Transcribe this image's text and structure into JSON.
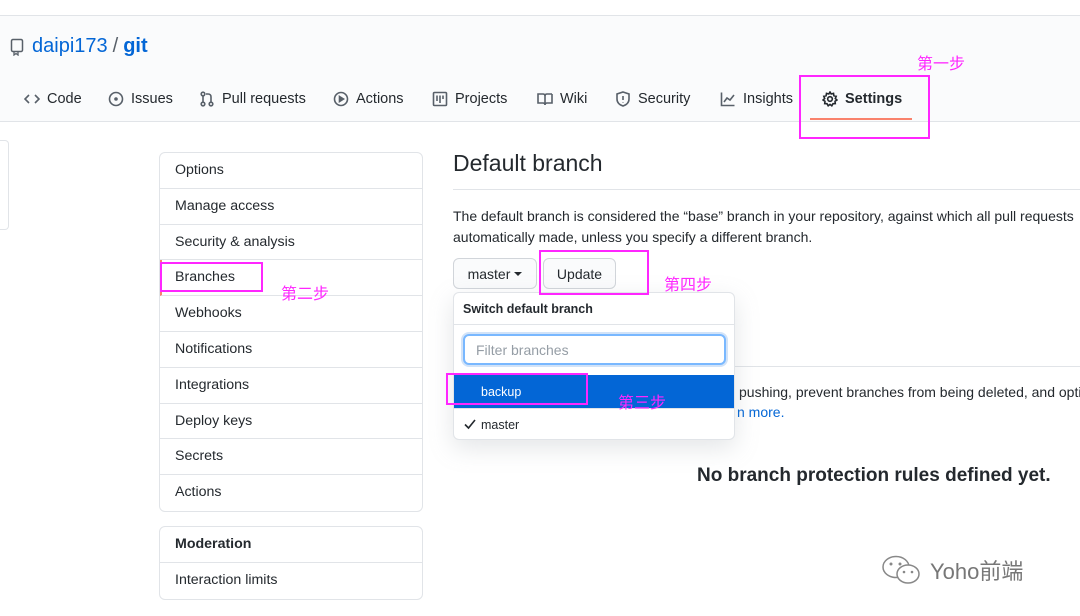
{
  "repo": {
    "owner": "daipi173",
    "separator": "/",
    "name": "git"
  },
  "tabs": [
    {
      "label": "Code",
      "icon": "code-icon"
    },
    {
      "label": "Issues",
      "icon": "issue-icon"
    },
    {
      "label": "Pull requests",
      "icon": "pull-request-icon"
    },
    {
      "label": "Actions",
      "icon": "play-icon"
    },
    {
      "label": "Projects",
      "icon": "project-icon"
    },
    {
      "label": "Wiki",
      "icon": "book-icon"
    },
    {
      "label": "Security",
      "icon": "shield-icon"
    },
    {
      "label": "Insights",
      "icon": "graph-icon"
    },
    {
      "label": "Settings",
      "icon": "gear-icon",
      "active": true
    }
  ],
  "sidebar": {
    "items": [
      "Options",
      "Manage access",
      "Security & analysis",
      "Branches",
      "Webhooks",
      "Notifications",
      "Integrations",
      "Deploy keys",
      "Secrets",
      "Actions"
    ],
    "selected": "Branches"
  },
  "moderation": {
    "heading": "Moderation",
    "items": [
      "Interaction limits"
    ]
  },
  "main": {
    "title": "Default branch",
    "desc_line1": "The default branch is considered the “base” branch in your repository, against which all pull requests",
    "desc_line2": "automatically made, unless you specify a different branch.",
    "branch_button": "master",
    "update_button": "Update"
  },
  "dropdown": {
    "title": "Switch default branch",
    "filter_placeholder": "Filter branches",
    "branches": [
      {
        "name": "backup",
        "highlighted": true
      },
      {
        "name": "master",
        "current": true
      }
    ]
  },
  "protection": {
    "text": "pushing, prevent branches from being deleted, and opti",
    "learn_more": "n more.",
    "no_rules": "No branch protection rules defined yet."
  },
  "annotations": {
    "step1": "第一步",
    "step2": "第二步",
    "step3": "第三步",
    "step4": "第四步",
    "color": "#ff26ff"
  },
  "watermark": {
    "text": "Yoho前端",
    "icon": "wechat-icon"
  },
  "colors": {
    "link": "#0366d6",
    "tab_underline": "#f9826c",
    "highlight": "#0366d6"
  }
}
